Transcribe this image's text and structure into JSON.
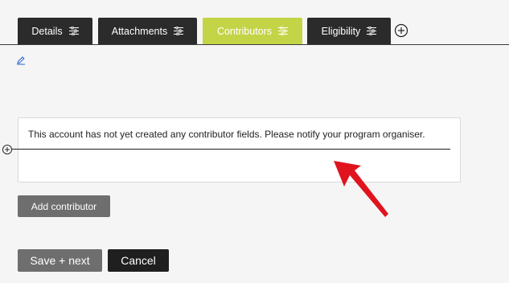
{
  "tabs": [
    {
      "label": "Details",
      "active": false
    },
    {
      "label": "Attachments",
      "active": false
    },
    {
      "label": "Contributors",
      "active": true
    },
    {
      "label": "Eligibility",
      "active": false
    }
  ],
  "icons": {
    "tab_settings": "sliders-icon",
    "add_tab": "plus-circle-icon",
    "edit": "pencil-icon",
    "insert_row": "plus-circle-icon"
  },
  "colors": {
    "tab_background": "#2b2b2b",
    "tab_active": "#c4d447",
    "link_blue": "#1a5fd0",
    "annotation_red": "#e0141e"
  },
  "notice": {
    "text": "This account has not yet created any contributor fields. Please notify your program organiser."
  },
  "buttons": {
    "add_contributor": "Add contributor",
    "save_next": "Save + next",
    "cancel": "Cancel"
  }
}
